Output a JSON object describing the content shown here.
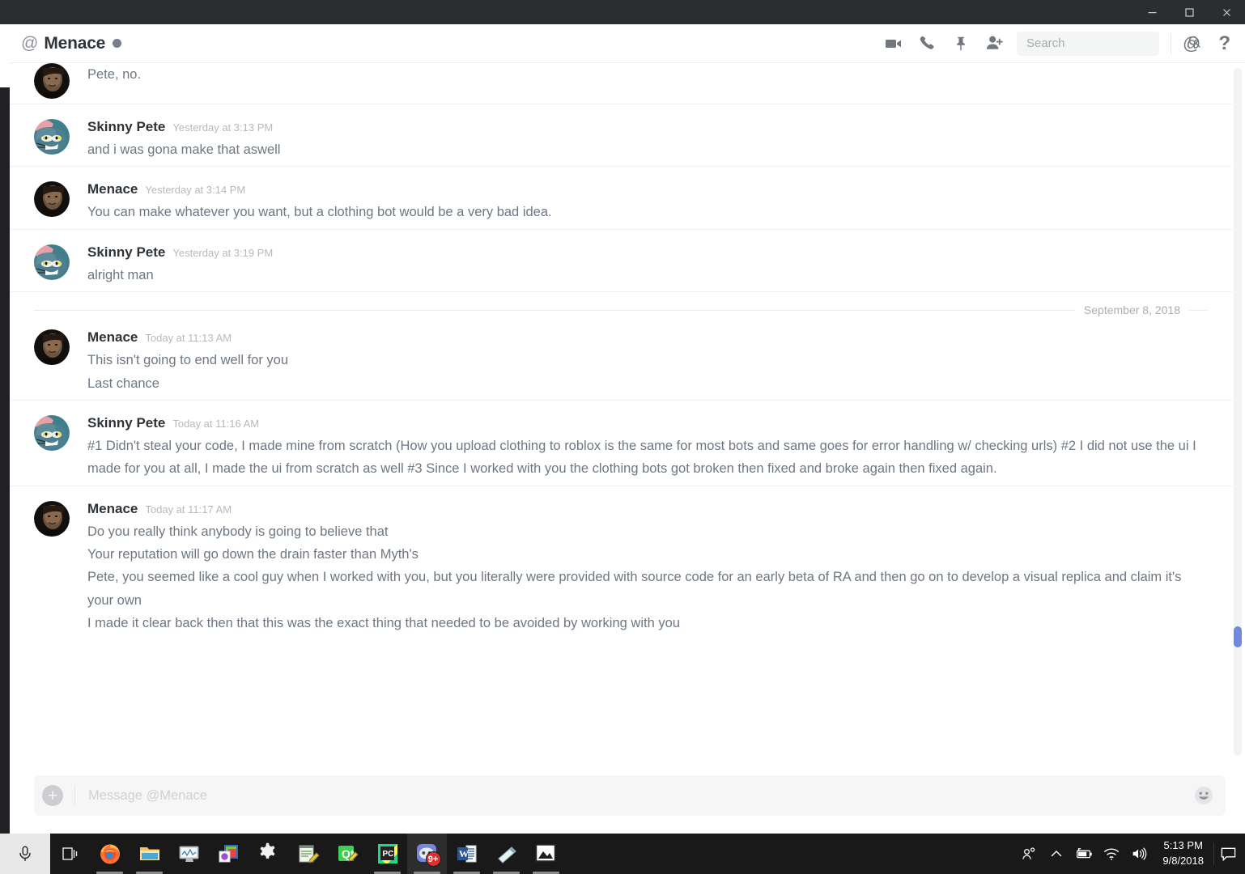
{
  "window": {
    "minimize_label": "Minimize",
    "maximize_label": "Maximize",
    "close_label": "Close"
  },
  "header": {
    "at_symbol": "@",
    "channel_name": "Menace",
    "status": "idle",
    "icons": [
      "video-camera-icon",
      "phone-icon",
      "pin-icon",
      "add-person-icon"
    ],
    "mentions_icon": "at-icon",
    "help_icon": "question-mark-icon"
  },
  "search": {
    "placeholder": "Search",
    "value": "",
    "icon": "search-icon"
  },
  "messages": [
    {
      "type": "continuation",
      "author": "Menace",
      "lines": [
        "Pete, no."
      ]
    },
    {
      "type": "group",
      "author": "Skinny Pete",
      "avatar": "tom-cat-avatar",
      "timestamp": "Yesterday at 3:13 PM",
      "lines": [
        "and i was gona make that aswell"
      ]
    },
    {
      "type": "group",
      "author": "Menace",
      "avatar": "man-photo-avatar",
      "timestamp": "Yesterday at 3:14 PM",
      "lines": [
        "You can make whatever you want, but a clothing bot would be a very bad idea."
      ]
    },
    {
      "type": "group",
      "author": "Skinny Pete",
      "avatar": "tom-cat-avatar",
      "timestamp": "Yesterday at 3:19 PM",
      "lines": [
        "alright man"
      ]
    },
    {
      "type": "divider",
      "date": "September 8, 2018"
    },
    {
      "type": "group",
      "author": "Menace",
      "avatar": "man-photo-avatar",
      "timestamp": "Today at 11:13 AM",
      "lines": [
        "This isn't going to end well for you",
        "Last chance"
      ]
    },
    {
      "type": "group",
      "author": "Skinny Pete",
      "avatar": "tom-cat-avatar",
      "timestamp": "Today at 11:16 AM",
      "lines": [
        "#1 Didn't steal your code, I made mine from scratch (How you upload clothing to roblox is the same for most bots and same goes for error handling w/ checking urls) #2 I did not use the ui I made for you at all, I made the ui from scratch as well #3 Since I worked with you the clothing bots got broken then fixed and broke again then fixed again."
      ]
    },
    {
      "type": "group",
      "author": "Menace",
      "avatar": "man-photo-avatar",
      "timestamp": "Today at 11:17 AM",
      "lines": [
        "Do you really think anybody is going to believe that",
        "Your reputation will go down the drain faster than Myth's",
        "Pete, you seemed like a cool guy when I worked with you, but you literally were provided with source code for an early beta of RA and then go on to develop a visual replica and claim it's your own",
        "I made it clear back then that this was the exact thing that needed to be avoided by working with you"
      ]
    }
  ],
  "composer": {
    "placeholder": "Message @Menace",
    "value": "",
    "add_icon": "plus-circle-icon",
    "emoji_icon": "smiley-face-icon"
  },
  "taskbar": {
    "start_icon": "cortana-microphone-icon",
    "task_view_icon": "task-view-icon",
    "apps": [
      {
        "name": "firefox-icon",
        "running": true,
        "active": false,
        "badge": null
      },
      {
        "name": "file-explorer-icon",
        "running": true,
        "active": false,
        "badge": null
      },
      {
        "name": "task-manager-icon",
        "running": false,
        "active": false,
        "badge": null
      },
      {
        "name": "color-app-icon",
        "running": false,
        "active": false,
        "badge": null
      },
      {
        "name": "settings-gear-icon",
        "running": false,
        "active": false,
        "badge": null
      },
      {
        "name": "notepad-editor-icon",
        "running": false,
        "active": false,
        "badge": null
      },
      {
        "name": "qt-creator-icon",
        "running": false,
        "active": false,
        "badge": null
      },
      {
        "name": "pycharm-icon",
        "running": true,
        "active": false,
        "badge": null
      },
      {
        "name": "discord-icon",
        "running": true,
        "active": true,
        "badge": "9+"
      },
      {
        "name": "word-icon",
        "running": true,
        "active": false,
        "badge": null
      },
      {
        "name": "sticky-notes-icon",
        "running": true,
        "active": false,
        "badge": null
      },
      {
        "name": "photos-icon",
        "running": true,
        "active": false,
        "badge": null
      }
    ],
    "tray": [
      "people-icon",
      "show-hidden-icons-chevron",
      "battery-icon",
      "wifi-icon",
      "volume-icon"
    ],
    "clock_time": "5:13 PM",
    "clock_date": "9/8/2018",
    "action_center_icon": "action-center-icon"
  },
  "colors": {
    "accent": "#7289da",
    "status_idle": "#747f8d",
    "taskbar_bg": "#191919",
    "titlebar_bg": "#2b2d31",
    "text_primary": "#2e3338",
    "text_body": "#6d7783",
    "text_muted": "#b5b9be"
  }
}
